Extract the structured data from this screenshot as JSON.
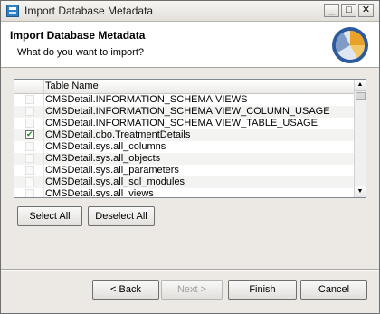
{
  "window": {
    "title": "Import Database Metadata",
    "controls": {
      "minimize": "_",
      "maximize": "□",
      "close": "✕"
    }
  },
  "header": {
    "title": "Import Database Metadata",
    "subtitle": "What do you want to import?"
  },
  "table": {
    "column_header": "Table Name",
    "rows": [
      {
        "name": "CMSDetail.INFORMATION_SCHEMA.VIEWS",
        "checked": false
      },
      {
        "name": "CMSDetail.INFORMATION_SCHEMA.VIEW_COLUMN_USAGE",
        "checked": false
      },
      {
        "name": "CMSDetail.INFORMATION_SCHEMA.VIEW_TABLE_USAGE",
        "checked": false
      },
      {
        "name": "CMSDetail.dbo.TreatmentDetails",
        "checked": true
      },
      {
        "name": "CMSDetail.sys.all_columns",
        "checked": false
      },
      {
        "name": "CMSDetail.sys.all_objects",
        "checked": false
      },
      {
        "name": "CMSDetail.sys.all_parameters",
        "checked": false
      },
      {
        "name": "CMSDetail.sys.all_sql_modules",
        "checked": false
      },
      {
        "name": "CMSDetail.sys.all_views",
        "checked": false
      }
    ]
  },
  "buttons": {
    "select_all": "Select All",
    "deselect_all": "Deselect All",
    "back": "< Back",
    "next": "Next >",
    "finish": "Finish",
    "cancel": "Cancel"
  },
  "colors": {
    "check": "#1a8a1a",
    "logo_blue": "#2c5a9c",
    "logo_orange": "#e8a228"
  }
}
